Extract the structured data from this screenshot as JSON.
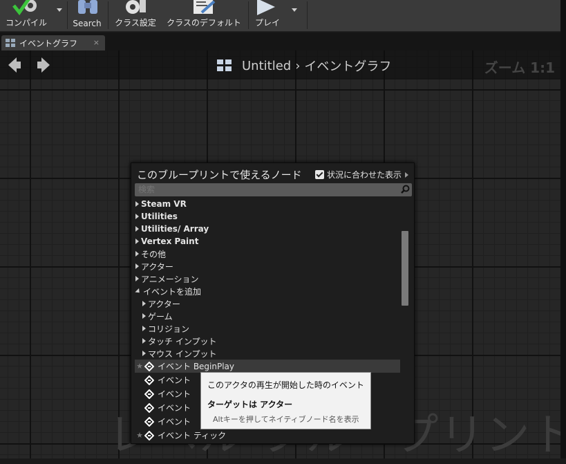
{
  "toolbar": {
    "compile_label": "コンパイル",
    "search_label": "Search",
    "class_settings_label": "クラス設定",
    "class_defaults_label": "クラスのデフォルト",
    "play_label": "プレイ"
  },
  "tab": {
    "label": "イベントグラフ",
    "close": "×"
  },
  "graph": {
    "breadcrumb_root": "Untitled",
    "breadcrumb_sep": "›",
    "breadcrumb_current": "イベントグラフ",
    "zoom": "ズーム 1:1",
    "watermark": "レベル ブループリント"
  },
  "menu": {
    "title": "このブループリントで使えるノード",
    "context_label": "状況に合わせた表示",
    "search_placeholder": "検索",
    "categories": [
      "Steam VR",
      "Utilities",
      "Utilities/ Array",
      "Vertex Paint",
      "その他",
      "アクター",
      "アニメーション"
    ],
    "expanded_category": "イベントを追加",
    "subcategories": [
      "アクター",
      "ゲーム",
      "コリジョン",
      "タッチ インプット",
      "マウス インプット"
    ],
    "events": [
      "イベント BeginPlay",
      "イベント",
      "イベント",
      "イベント",
      "イベント",
      "イベント ティック"
    ]
  },
  "tooltip": {
    "description": "このアクタの再生が開始した時のイベント",
    "target": "ターゲットは アクター",
    "hint": "Altキーを押してネイティブノード名を表示"
  }
}
